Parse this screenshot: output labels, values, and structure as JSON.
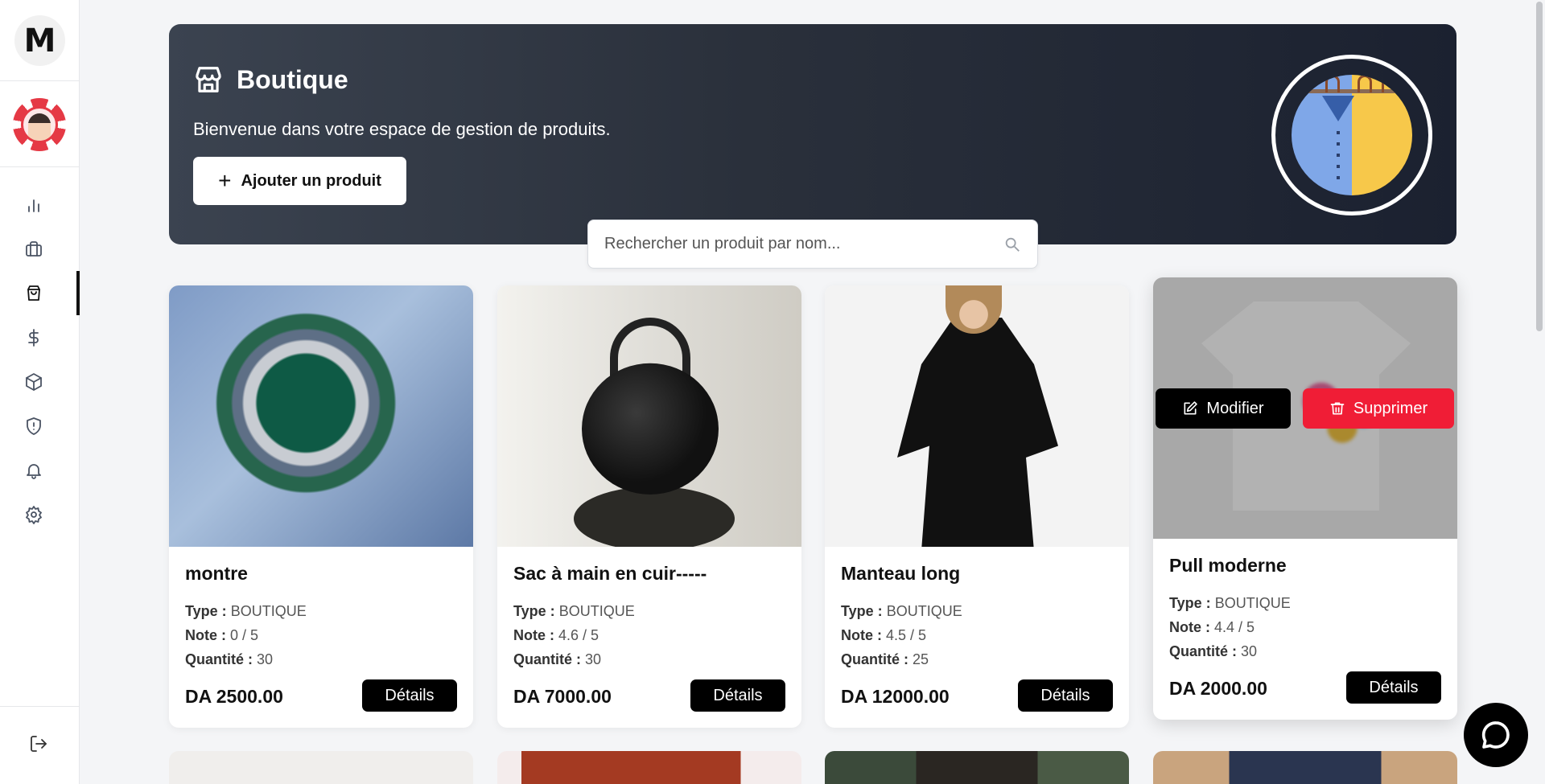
{
  "sidebar": {
    "logo_letter": "M",
    "nav": [
      "stats",
      "briefcase",
      "shopping-bag",
      "dollar",
      "box",
      "shield",
      "bell",
      "settings"
    ],
    "active": "shopping-bag"
  },
  "hero": {
    "title": "Boutique",
    "subtitle": "Bienvenue dans votre espace de gestion de produits.",
    "add_button": "Ajouter un produit"
  },
  "search": {
    "placeholder": "Rechercher un produit par nom..."
  },
  "labels": {
    "type": "Type :",
    "note": "Note :",
    "quantity": "Quantité :",
    "details": "Détails",
    "modify": "Modifier",
    "delete": "Supprimer"
  },
  "products": [
    {
      "name": "montre",
      "type": "BOUTIQUE",
      "note": "0 / 5",
      "quantity": "30",
      "price": "DA 2500.00"
    },
    {
      "name": "Sac à main en cuir-----",
      "type": "BOUTIQUE",
      "note": "4.6 / 5",
      "quantity": "30",
      "price": "DA 7000.00"
    },
    {
      "name": "Manteau long",
      "type": "BOUTIQUE",
      "note": "4.5 / 5",
      "quantity": "25",
      "price": "DA 12000.00"
    },
    {
      "name": "Pull moderne",
      "type": "BOUTIQUE",
      "note": "4.4 / 5",
      "quantity": "30",
      "price": "DA 2000.00"
    }
  ],
  "colors": {
    "accent": "#000000",
    "danger": "#f01d36",
    "hero_dark": "#1b2130"
  }
}
